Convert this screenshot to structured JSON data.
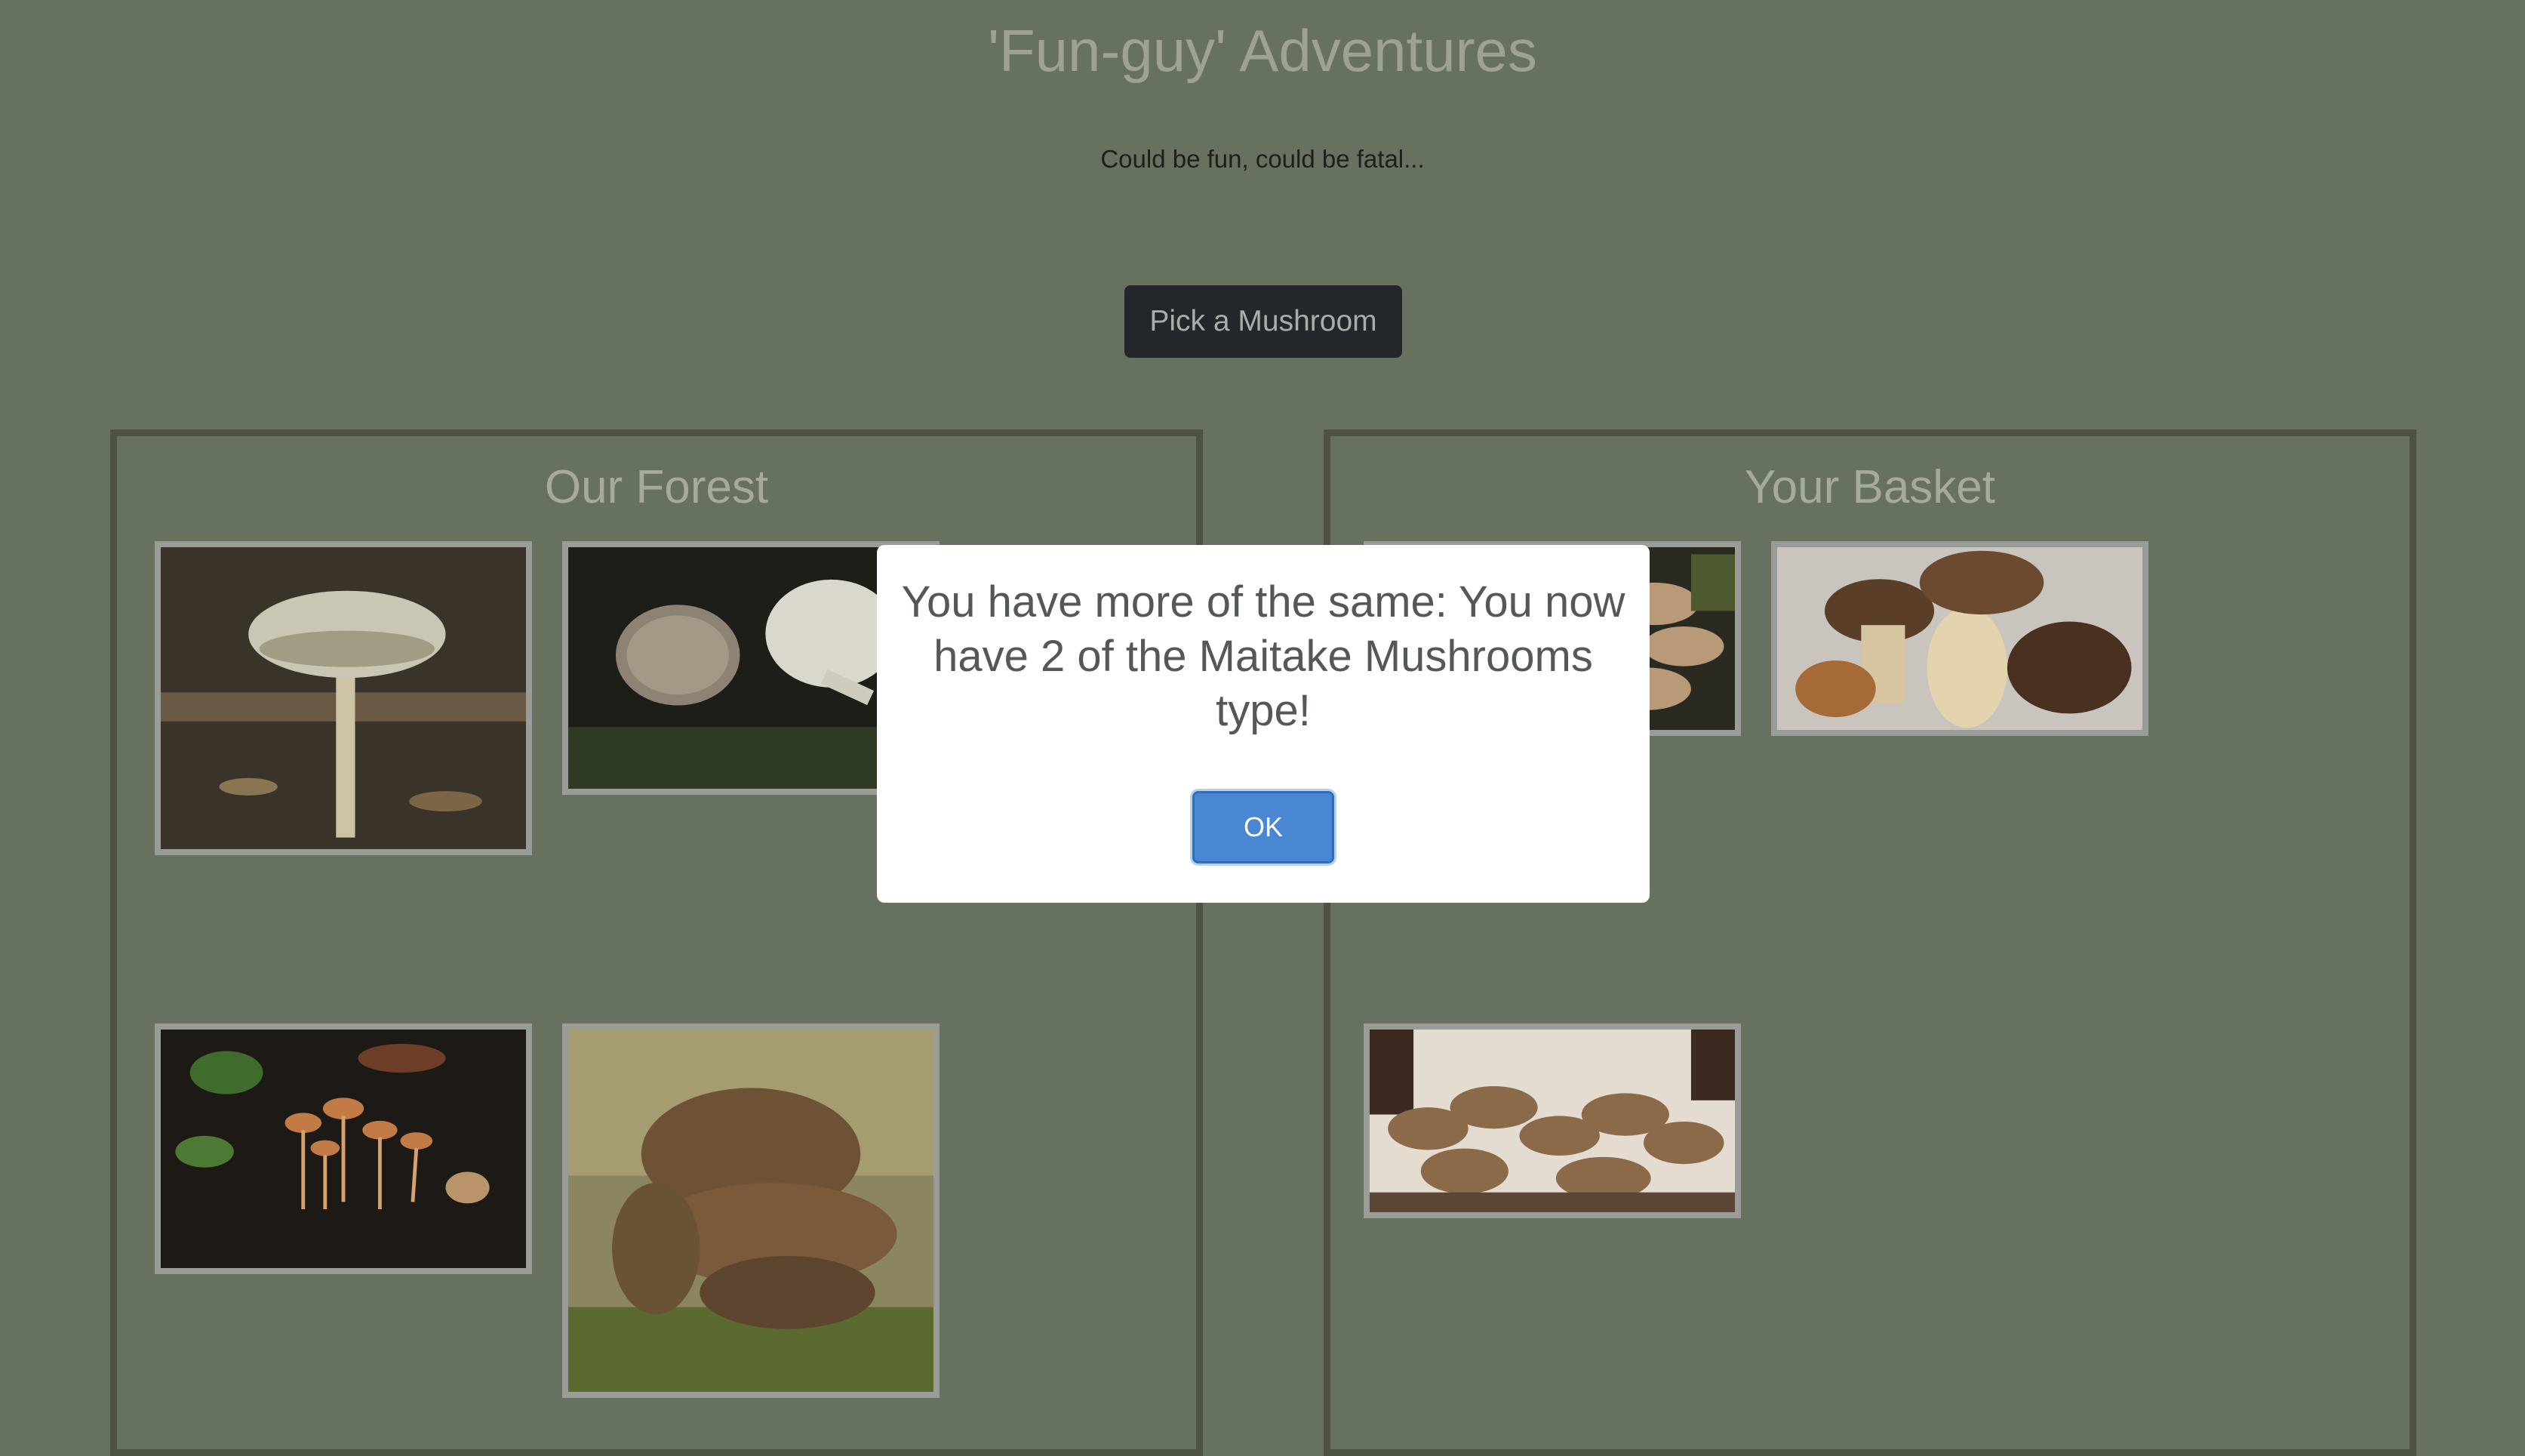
{
  "header": {
    "title": "'Fun-guy' Adventures",
    "subtitle": "Could be fun, could be fatal...",
    "pick_button_label": "Pick a Mushroom"
  },
  "forest": {
    "title": "Our Forest",
    "items": [
      {
        "icon": "amanita-mushroom-photo"
      },
      {
        "icon": "parasol-mushrooms-photo"
      },
      {
        "icon": "orange-cluster-mushrooms-photo"
      },
      {
        "icon": "brown-gilled-mushroom-photo"
      }
    ]
  },
  "basket": {
    "title": "Your Basket",
    "items": [
      {
        "icon": "maitake-mushroom-photo"
      },
      {
        "icon": "porcini-mushrooms-photo"
      },
      {
        "icon": "maitake-mushroom-photo"
      }
    ]
  },
  "dialog": {
    "message": "You have more of the same: You now have 2 of the Maitake Mushrooms type!",
    "ok_label": "OK"
  },
  "colors": {
    "background": "#677160",
    "panel_border": "#4c5345",
    "button_dark": "#23272b",
    "ok_blue": "#4a87d2"
  }
}
